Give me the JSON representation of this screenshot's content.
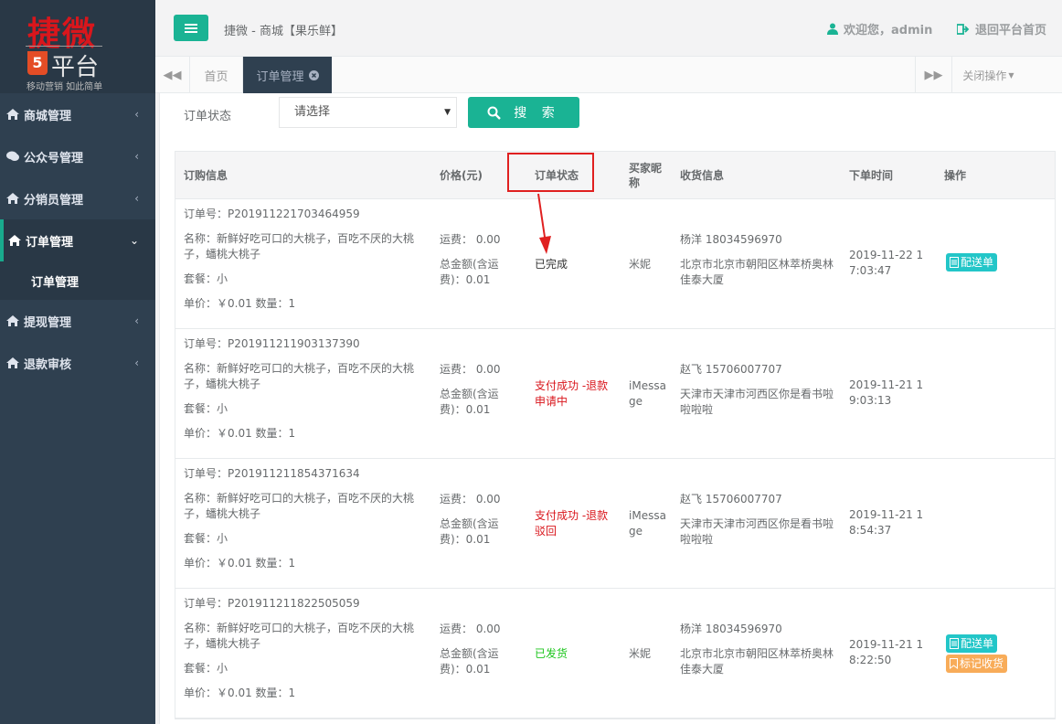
{
  "sidebar": {
    "logo_title": "捷微",
    "logo_h5": "5",
    "logo_platform": "平台",
    "logo_slogan": "移动营销 如此简单",
    "items": [
      {
        "label": "商城管理"
      },
      {
        "label": "公众号管理"
      },
      {
        "label": "分销员管理"
      },
      {
        "label": "订单管理"
      },
      {
        "label": "提现管理"
      },
      {
        "label": "退款审核"
      }
    ],
    "sub_item": "订单管理"
  },
  "header": {
    "breadcrumb": "捷微 - 商城【果乐鲜】",
    "welcome": "欢迎您，admin",
    "exit": "退回平台首页"
  },
  "tabs": {
    "home": "首页",
    "active": "订单管理",
    "close_ops": "关闭操作"
  },
  "search": {
    "label": "订单状态",
    "select_value": "请选择",
    "button": "搜 索"
  },
  "table": {
    "headers": {
      "info": "订购信息",
      "price": "价格(元)",
      "status": "订单状态",
      "buyer": "买家昵称",
      "address": "收货信息",
      "time": "下单时间",
      "ops": "操作"
    },
    "rows": [
      {
        "order_no": "订单号：P201911221703464959",
        "name": "名称：新鲜好吃可口的大桃子，百吃不厌的大桃子，蟠桃大桃子",
        "package": "套餐：小",
        "unit": "单价：￥0.01 数量：1",
        "freight": "运费： 0.00",
        "total": "总金额(含运费)：0.01",
        "status": "已完成",
        "buyer": "米妮",
        "contact": "杨洋 18034596970",
        "address": "北京市北京市朝阳区林萃桥奥林佳泰大厦",
        "time": "2019-11-22 17:03:47",
        "op1": "配送单",
        "op2": ""
      },
      {
        "order_no": "订单号：P201911211903137390",
        "name": "名称：新鲜好吃可口的大桃子，百吃不厌的大桃子，蟠桃大桃子",
        "package": "套餐：小",
        "unit": "单价：￥0.01 数量：1",
        "freight": "运费： 0.00",
        "total": "总金额(含运费)：0.01",
        "status": "支付成功 -退款申请中",
        "buyer": "iMessage",
        "contact": "赵飞 15706007707",
        "address": "天津市天津市河西区你是看书啦啦啦啦",
        "time": "2019-11-21 19:03:13",
        "op1": "",
        "op2": ""
      },
      {
        "order_no": "订单号：P201911211854371634",
        "name": "名称：新鲜好吃可口的大桃子，百吃不厌的大桃子，蟠桃大桃子",
        "package": "套餐：小",
        "unit": "单价：￥0.01 数量：1",
        "freight": "运费： 0.00",
        "total": "总金额(含运费)：0.01",
        "status": "支付成功 -退款驳回",
        "buyer": "iMessage",
        "contact": "赵飞 15706007707",
        "address": "天津市天津市河西区你是看书啦啦啦啦",
        "time": "2019-11-21 18:54:37",
        "op1": "",
        "op2": ""
      },
      {
        "order_no": "订单号：P201911211822505059",
        "name": "名称：新鲜好吃可口的大桃子，百吃不厌的大桃子，蟠桃大桃子",
        "package": "套餐：小",
        "unit": "单价：￥0.01 数量：1",
        "freight": "运费： 0.00",
        "total": "总金额(含运费)：0.01",
        "status": "已发货",
        "buyer": "米妮",
        "contact": "杨洋 18034596970",
        "address": "北京市北京市朝阳区林萃桥奥林佳泰大厦",
        "time": "2019-11-21 18:22:50",
        "op1": "配送单",
        "op2": "标记收货"
      }
    ]
  },
  "colors": {
    "sidebar_bg": "#2f4050",
    "accent": "#1ab394",
    "status_red": "#d9161c",
    "status_green": "#1cc51c",
    "highlight": "#e02020"
  }
}
